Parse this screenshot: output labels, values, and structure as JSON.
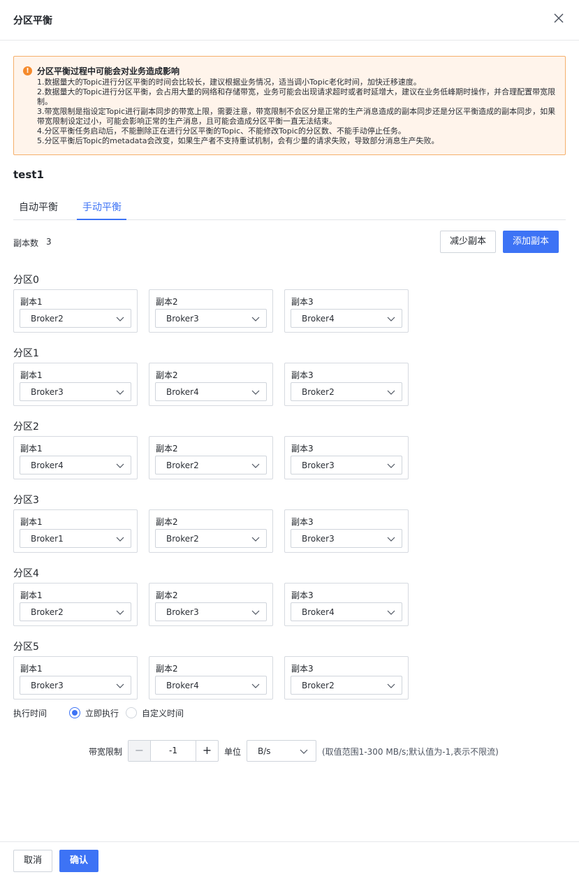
{
  "dialog": {
    "title": "分区平衡"
  },
  "alert": {
    "title": "分区平衡过程中可能会对业务造成影响",
    "lines": [
      "1.数据量大的Topic进行分区平衡的时间会比较长，建议根据业务情况，适当调小Topic老化时间，加快迁移速度。",
      "2.数据量大的Topic进行分区平衡，会占用大量的网络和存储带宽，业务可能会出现请求超时或者时延增大，建议在业务低峰期时操作，并合理配置带宽限制。",
      "3.带宽限制是指设定Topic进行副本同步的带宽上限，需要注意，带宽限制不会区分是正常的生产消息造成的副本同步还是分区平衡造成的副本同步，如果带宽限制设定过小，可能会影响正常的生产消息，且可能会造成分区平衡一直无法结束。",
      "4.分区平衡任务启动后，不能删除正在进行分区平衡的Topic、不能修改Topic的分区数、不能手动停止任务。",
      "5.分区平衡后Topic的metadata会改变，如果生产者不支持重试机制，会有少量的请求失败，导致部分消息生产失败。"
    ]
  },
  "topic_name": "test1",
  "tabs": [
    {
      "label": "自动平衡"
    },
    {
      "label": "手动平衡"
    }
  ],
  "replica": {
    "label": "副本数",
    "count": "3",
    "reduce_label": "减少副本",
    "add_label": "添加副本"
  },
  "partitions": [
    {
      "title": "分区0",
      "replicas": [
        {
          "label": "副本1",
          "broker": "Broker2"
        },
        {
          "label": "副本2",
          "broker": "Broker3"
        },
        {
          "label": "副本3",
          "broker": "Broker4"
        }
      ]
    },
    {
      "title": "分区1",
      "replicas": [
        {
          "label": "副本1",
          "broker": "Broker3"
        },
        {
          "label": "副本2",
          "broker": "Broker4"
        },
        {
          "label": "副本3",
          "broker": "Broker2"
        }
      ]
    },
    {
      "title": "分区2",
      "replicas": [
        {
          "label": "副本1",
          "broker": "Broker4"
        },
        {
          "label": "副本2",
          "broker": "Broker2"
        },
        {
          "label": "副本3",
          "broker": "Broker3"
        }
      ]
    },
    {
      "title": "分区3",
      "replicas": [
        {
          "label": "副本1",
          "broker": "Broker1"
        },
        {
          "label": "副本2",
          "broker": "Broker2"
        },
        {
          "label": "副本3",
          "broker": "Broker3"
        }
      ]
    },
    {
      "title": "分区4",
      "replicas": [
        {
          "label": "副本1",
          "broker": "Broker2"
        },
        {
          "label": "副本2",
          "broker": "Broker3"
        },
        {
          "label": "副本3",
          "broker": "Broker4"
        }
      ]
    },
    {
      "title": "分区5",
      "replicas": [
        {
          "label": "副本1",
          "broker": "Broker3"
        },
        {
          "label": "副本2",
          "broker": "Broker4"
        },
        {
          "label": "副本3",
          "broker": "Broker2"
        }
      ]
    }
  ],
  "exec_time": {
    "label": "执行时间",
    "immediate": "立即执行",
    "custom": "自定义时间"
  },
  "bandwidth": {
    "label": "带宽限制",
    "value": "-1",
    "unit_label": "单位",
    "unit_value": "B/s",
    "hint": "(取值范围1-300 MB/s;默认值为-1,表示不限流)"
  },
  "footer": {
    "cancel_label": "取消",
    "confirm_label": "确认"
  },
  "colors": {
    "primary": "#3d73f5",
    "warning": "#f58a2c",
    "alert_bg": "#fff4eb"
  }
}
